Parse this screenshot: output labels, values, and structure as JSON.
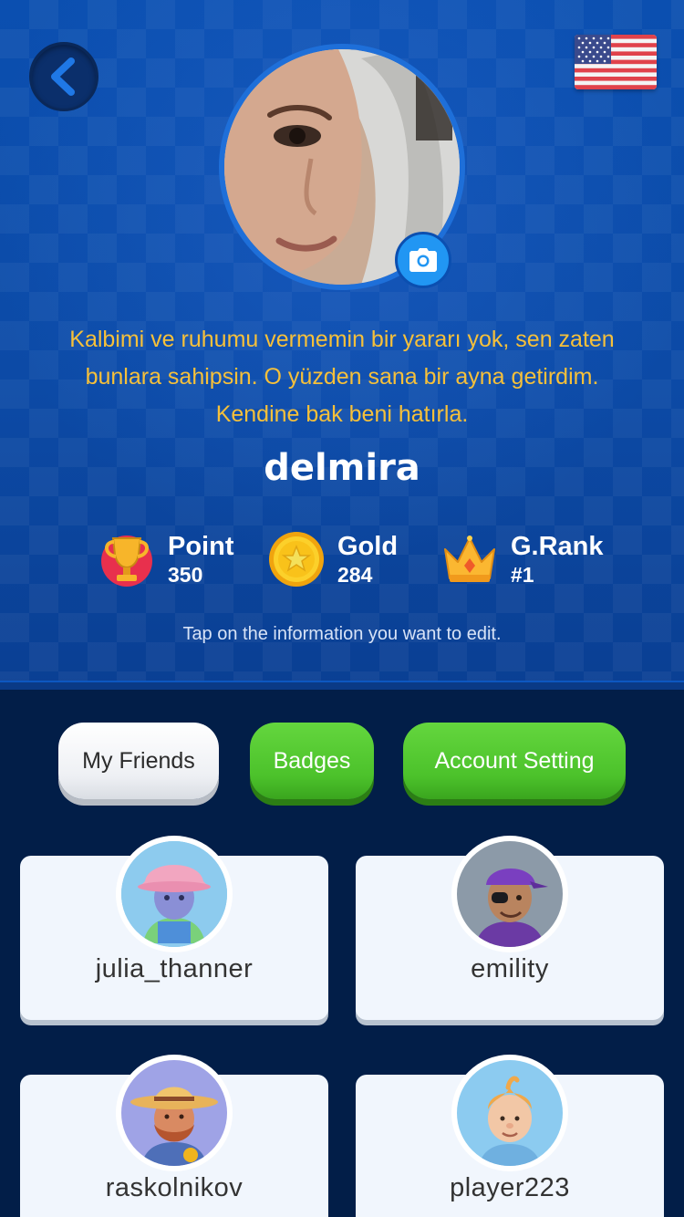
{
  "header": {
    "back_icon": "chevron-left-icon",
    "language_flag": "us-flag-icon",
    "camera_icon": "camera-icon",
    "bio_lines": [
      "Kalbimi ve ruhumu vermemin bir yararı yok, sen zaten",
      "bunlara sahipsin. O yüzden sana bir ayna getirdim.",
      "Kendine bak beni hatırla."
    ],
    "username": "delmira",
    "stats": [
      {
        "label": "Point",
        "value": "350",
        "icon": "trophy-icon"
      },
      {
        "label": "Gold",
        "value": "284",
        "icon": "gold-coin-icon"
      },
      {
        "label": "G.Rank",
        "value": "#1",
        "icon": "crown-icon"
      }
    ],
    "hint": "Tap on the information you want to edit."
  },
  "tabs": [
    {
      "label": "My Friends",
      "active": true
    },
    {
      "label": "Badges",
      "active": false
    },
    {
      "label": "Account Setting",
      "active": false
    }
  ],
  "friends": [
    {
      "name": "julia_thanner",
      "avatar": "avatar-pink-hat-icon"
    },
    {
      "name": "emility",
      "avatar": "avatar-purple-cap-icon"
    },
    {
      "name": "raskolnikov",
      "avatar": "avatar-straw-hat-icon"
    },
    {
      "name": "player223",
      "avatar": "avatar-blond-boy-icon"
    }
  ],
  "colors": {
    "header_blue": "#0b4fb0",
    "bio_yellow": "#f6c03a",
    "page_navy": "#021e48",
    "button_green": "#4cc22b",
    "card_bg": "#f1f6fd"
  }
}
